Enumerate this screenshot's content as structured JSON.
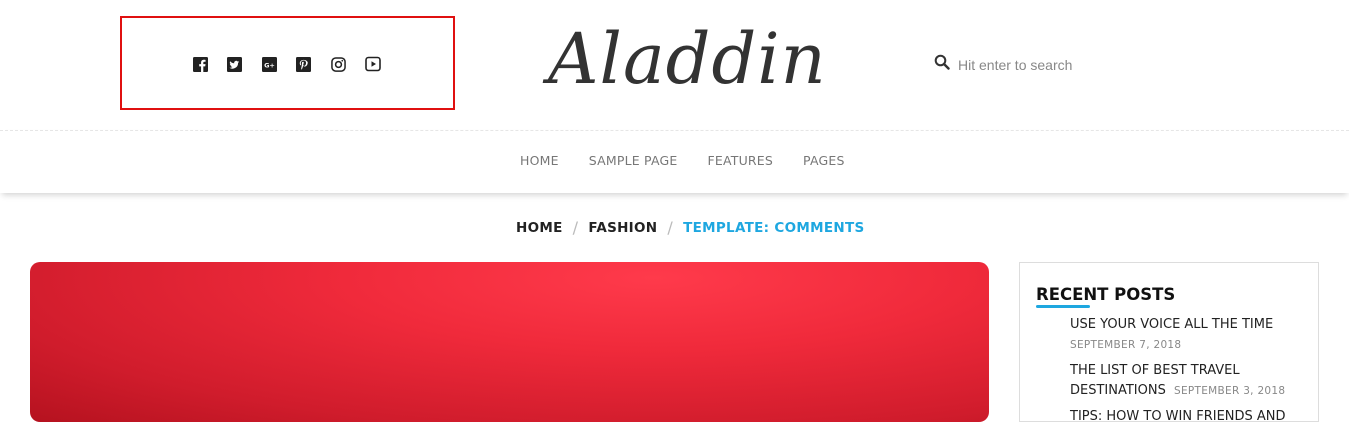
{
  "site": {
    "logo": "Aladdin"
  },
  "social": {
    "icons": [
      "facebook-icon",
      "twitter-icon",
      "google-plus-icon",
      "pinterest-icon",
      "instagram-icon",
      "youtube-icon"
    ],
    "highlight_color": "#e01010"
  },
  "search": {
    "placeholder": "Hit enter to search"
  },
  "nav": {
    "items": [
      "HOME",
      "SAMPLE PAGE",
      "FEATURES",
      "PAGES"
    ]
  },
  "breadcrumb": {
    "items": [
      "HOME",
      "FASHION"
    ],
    "current": "TEMPLATE: COMMENTS",
    "separator": "/"
  },
  "colors": {
    "accent": "#1ea7e0",
    "hero": "#e8283a"
  },
  "sidebar": {
    "widget_title": "RECENT POSTS",
    "posts": [
      {
        "title": "USE YOUR VOICE ALL THE TIME",
        "date": "SEPTEMBER 7, 2018"
      },
      {
        "title": "THE LIST OF BEST TRAVEL DESTINATIONS",
        "date": "SEPTEMBER 3, 2018"
      },
      {
        "title": "TIPS: HOW TO WIN FRIENDS AND",
        "date": ""
      }
    ]
  }
}
